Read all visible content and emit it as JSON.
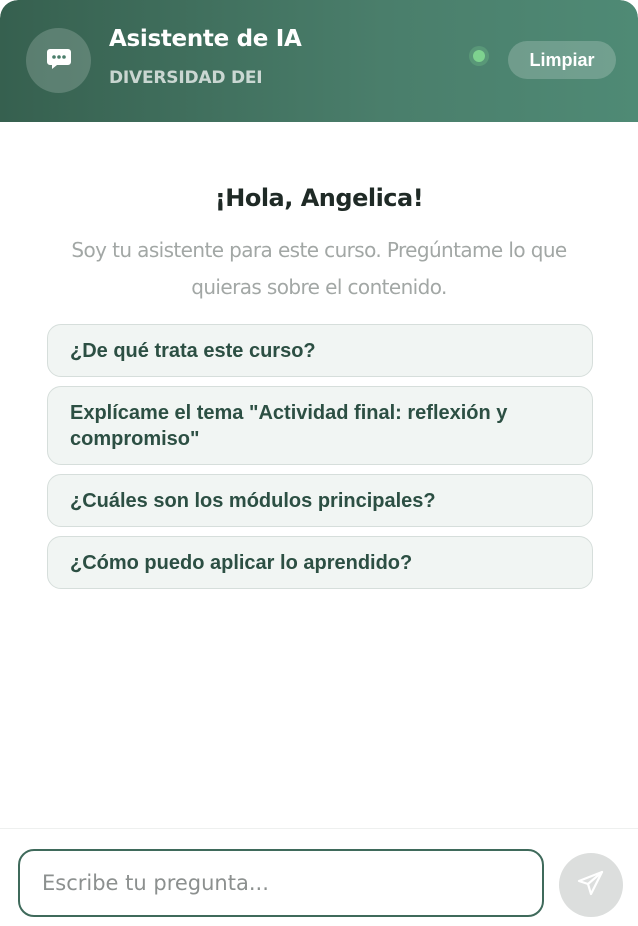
{
  "header": {
    "title": "Asistente de IA",
    "subtitle": "DIVERSIDAD DEI",
    "clear_label": "Limpiar",
    "status_color": "#7ed28f",
    "avatar_icon": "chat-bubble-icon"
  },
  "welcome": {
    "greeting": "¡Hola, Angelica!",
    "intro": "Soy tu asistente para este curso. Pregúntame lo que quieras sobre el contenido."
  },
  "suggestions": [
    "¿De qué trata este curso?",
    "Explícame el tema \"Actividad final: reflexión y compromiso\"",
    "¿Cuáles son los módulos principales?",
    "¿Cómo puedo aplicar lo aprendido?"
  ],
  "composer": {
    "placeholder": "Escribe tu pregunta...",
    "send_icon": "send-icon"
  },
  "colors": {
    "header_start": "#36604f",
    "header_end": "#4f8a75",
    "suggestion_text": "#2c4f43",
    "suggestion_bg": "#f1f5f3",
    "input_border": "#3f6a5b"
  }
}
